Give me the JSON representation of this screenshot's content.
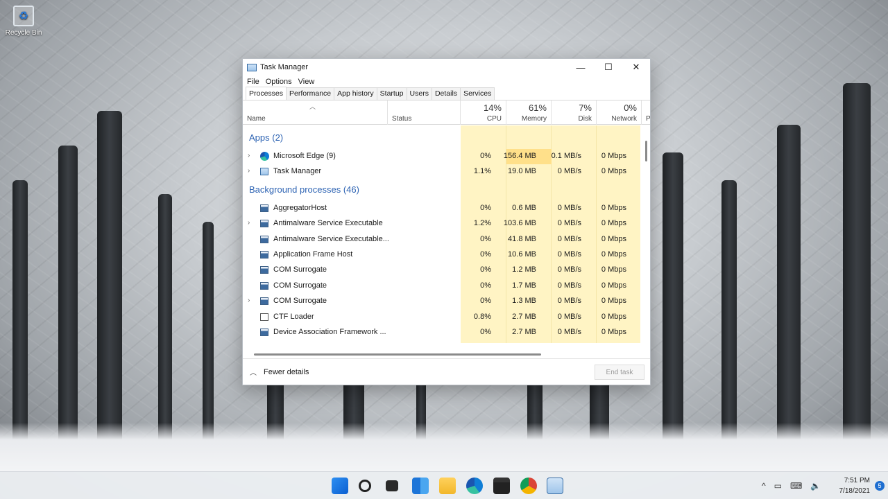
{
  "desktop": {
    "recycle_bin": "Recycle Bin"
  },
  "window": {
    "title": "Task Manager",
    "controls": {
      "minimize": "—",
      "maximize": "☐",
      "close": "✕"
    },
    "menu": [
      "File",
      "Options",
      "View"
    ],
    "tabs": [
      "Processes",
      "Performance",
      "App history",
      "Startup",
      "Users",
      "Details",
      "Services"
    ],
    "active_tab": "Processes",
    "columns": {
      "name": "Name",
      "status": "Status",
      "cpu": {
        "pct": "14%",
        "label": "CPU"
      },
      "memory": {
        "pct": "61%",
        "label": "Memory"
      },
      "disk": {
        "pct": "7%",
        "label": "Disk"
      },
      "network": {
        "pct": "0%",
        "label": "Network"
      },
      "power_partial": "Po"
    },
    "sections": {
      "apps": "Apps (2)",
      "background": "Background processes (46)"
    },
    "apps": [
      {
        "name": "Microsoft Edge (9)",
        "cpu": "0%",
        "memory": "156.4 MB",
        "disk": "0.1 MB/s",
        "network": "0 Mbps",
        "icon": "edge-icon"
      },
      {
        "name": "Task Manager",
        "cpu": "1.1%",
        "memory": "19.0 MB",
        "disk": "0 MB/s",
        "network": "0 Mbps",
        "icon": "task-manager-icon"
      }
    ],
    "background": [
      {
        "name": "AggregatorHost",
        "cpu": "0%",
        "memory": "0.6 MB",
        "disk": "0 MB/s",
        "network": "0 Mbps"
      },
      {
        "name": "Antimalware Service Executable",
        "cpu": "1.2%",
        "memory": "103.6 MB",
        "disk": "0 MB/s",
        "network": "0 Mbps"
      },
      {
        "name": "Antimalware Service Executable...",
        "cpu": "0%",
        "memory": "41.8 MB",
        "disk": "0 MB/s",
        "network": "0 Mbps"
      },
      {
        "name": "Application Frame Host",
        "cpu": "0%",
        "memory": "10.6 MB",
        "disk": "0 MB/s",
        "network": "0 Mbps"
      },
      {
        "name": "COM Surrogate",
        "cpu": "0%",
        "memory": "1.2 MB",
        "disk": "0 MB/s",
        "network": "0 Mbps"
      },
      {
        "name": "COM Surrogate",
        "cpu": "0%",
        "memory": "1.7 MB",
        "disk": "0 MB/s",
        "network": "0 Mbps"
      },
      {
        "name": "COM Surrogate",
        "cpu": "0%",
        "memory": "1.3 MB",
        "disk": "0 MB/s",
        "network": "0 Mbps"
      },
      {
        "name": "CTF Loader",
        "cpu": "0.8%",
        "memory": "2.7 MB",
        "disk": "0 MB/s",
        "network": "0 Mbps"
      },
      {
        "name": "Device Association Framework ...",
        "cpu": "0%",
        "memory": "2.7 MB",
        "disk": "0 MB/s",
        "network": "0 Mbps"
      }
    ],
    "footer": {
      "fewer_details": "Fewer details",
      "end_task": "End task"
    }
  },
  "taskbar": {
    "icons": [
      "start-icon",
      "search-icon",
      "task-view-icon",
      "widgets-icon",
      "file-explorer-icon",
      "edge-icon",
      "store-icon",
      "chrome-icon",
      "task-manager-icon"
    ],
    "time": "7:51 PM",
    "date": "7/18/2021",
    "notifications": "5"
  }
}
